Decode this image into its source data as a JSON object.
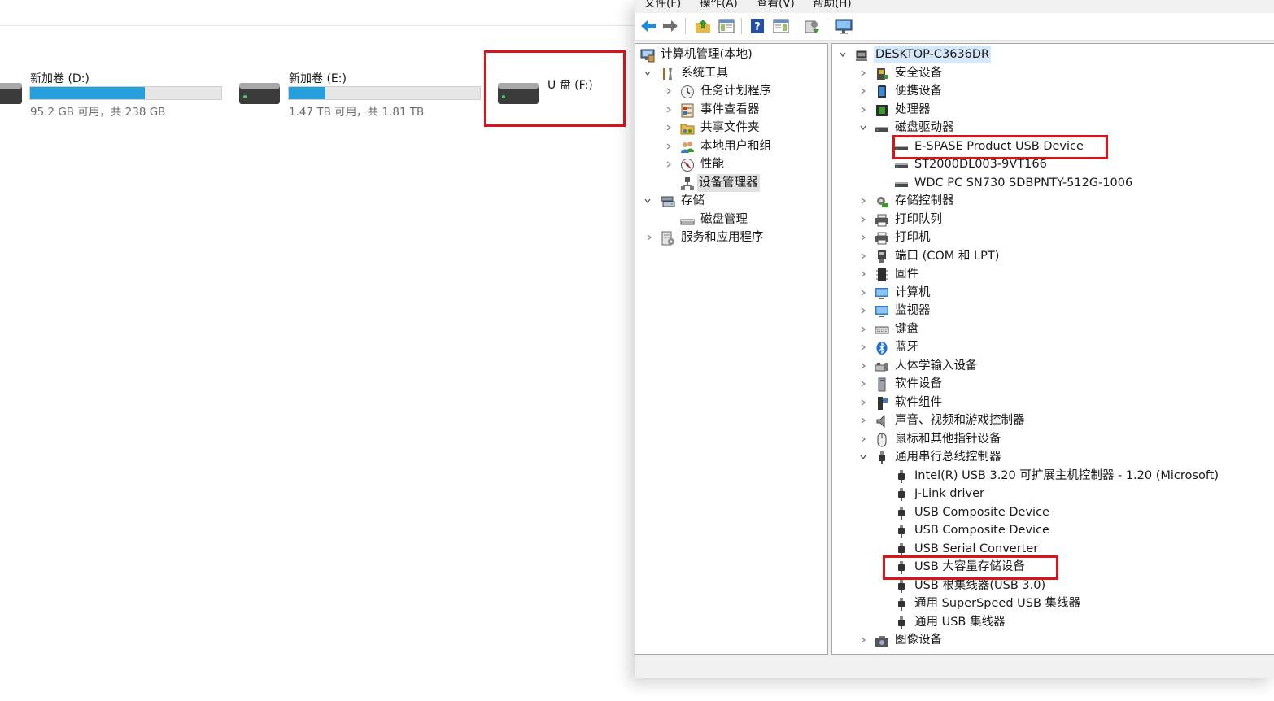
{
  "explorer": {
    "drives": [
      {
        "name": "新加卷 (D:)",
        "info": "95.2 GB 可用，共 238 GB",
        "used_fraction": 0.6
      },
      {
        "name": "新加卷 (E:)",
        "info": "1.47 TB 可用，共 1.81 TB",
        "used_fraction": 0.19
      },
      {
        "name": "U 盘 (F:)",
        "info": "",
        "used_fraction": null
      }
    ]
  },
  "mmc": {
    "menu": [
      "文件(F)",
      "操作(A)",
      "查看(V)",
      "帮助(H)"
    ],
    "toolbar": [
      "back-icon",
      "forward-icon",
      "up-folder-icon",
      "show-tree-icon",
      "help-icon",
      "action-pane-icon",
      "properties-icon",
      "monitor-icon"
    ],
    "nav": {
      "root": "计算机管理(本地)",
      "system_tools": "系统工具",
      "task_scheduler": "任务计划程序",
      "event_viewer": "事件查看器",
      "shared_folders": "共享文件夹",
      "local_users": "本地用户和组",
      "performance": "性能",
      "device_manager": "设备管理器",
      "storage": "存储",
      "disk_management": "磁盘管理",
      "services_apps": "服务和应用程序"
    },
    "devices": {
      "computer": "DESKTOP-C3636DR",
      "security": "安全设备",
      "portable": "便携设备",
      "processors": "处理器",
      "disk_drives": "磁盘驱动器",
      "disk_1": "E-SPASE Product USB Device",
      "disk_2": "ST2000DL003-9VT166",
      "disk_3": "WDC PC SN730 SDBPNTY-512G-1006",
      "storage_controllers": "存储控制器",
      "print_queues": "打印队列",
      "printers": "打印机",
      "ports": "端口 (COM 和 LPT)",
      "firmware": "固件",
      "computer_cat": "计算机",
      "monitors": "监视器",
      "keyboards": "键盘",
      "bluetooth": "蓝牙",
      "hid": "人体学输入设备",
      "software_devices": "软件设备",
      "software_components": "软件组件",
      "audio": "声音、视频和游戏控制器",
      "mice": "鼠标和其他指针设备",
      "usb_controllers": "通用串行总线控制器",
      "usb_1": "Intel(R) USB 3.20 可扩展主机控制器 - 1.20 (Microsoft)",
      "usb_2": "J-Link driver",
      "usb_3": "USB Composite Device",
      "usb_4": "USB Composite Device",
      "usb_5": "USB Serial Converter",
      "usb_6": "USB 大容量存储设备",
      "usb_7": "USB 根集线器(USB 3.0)",
      "usb_8": "通用 SuperSpeed USB 集线器",
      "usb_9": "通用 USB 集线器",
      "imaging": "图像设备"
    }
  },
  "colors": {
    "drive_bar_fill": "#26a0da",
    "annotation_red": "#d9141b",
    "selection_blue": "#d6e8fb"
  }
}
